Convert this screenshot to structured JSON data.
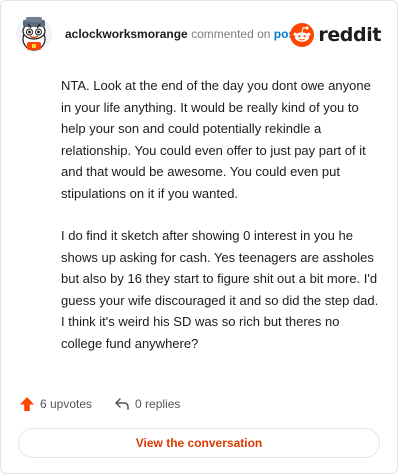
{
  "comment": {
    "username": "aclockworksmorange",
    "action_text": "commented on",
    "post_link": "post",
    "paragraphs": [
      "NTA. Look at the end of the day you dont owe anyone in your life anything. It would be really kind of you to help your son and could potentially rekindle a relationship. You could even offer to just pay part of it and that would be awesome. You could even put stipulations on it if you wanted.",
      "I do find it sketch after showing 0 interest in you he shows up asking for cash. Yes teenagers are assholes but also by 16 they start to figure shit out a bit more. I'd guess your wife discouraged it and so did the step dad. I think it's weird his SD was so rich but theres no college fund anywhere?"
    ]
  },
  "brand": {
    "name": "reddit",
    "accent": "#ff4500"
  },
  "footer": {
    "upvotes": "6 upvotes",
    "replies": "0 replies",
    "upvote_color": "#ff4500"
  },
  "cta": {
    "label": "View the conversation",
    "color": "#d93a00"
  },
  "icons": {
    "avatar": "snoo-avatar-icon",
    "logo": "reddit-logo-icon",
    "upvote": "upvote-arrow-icon",
    "reply": "reply-arrow-icon"
  }
}
